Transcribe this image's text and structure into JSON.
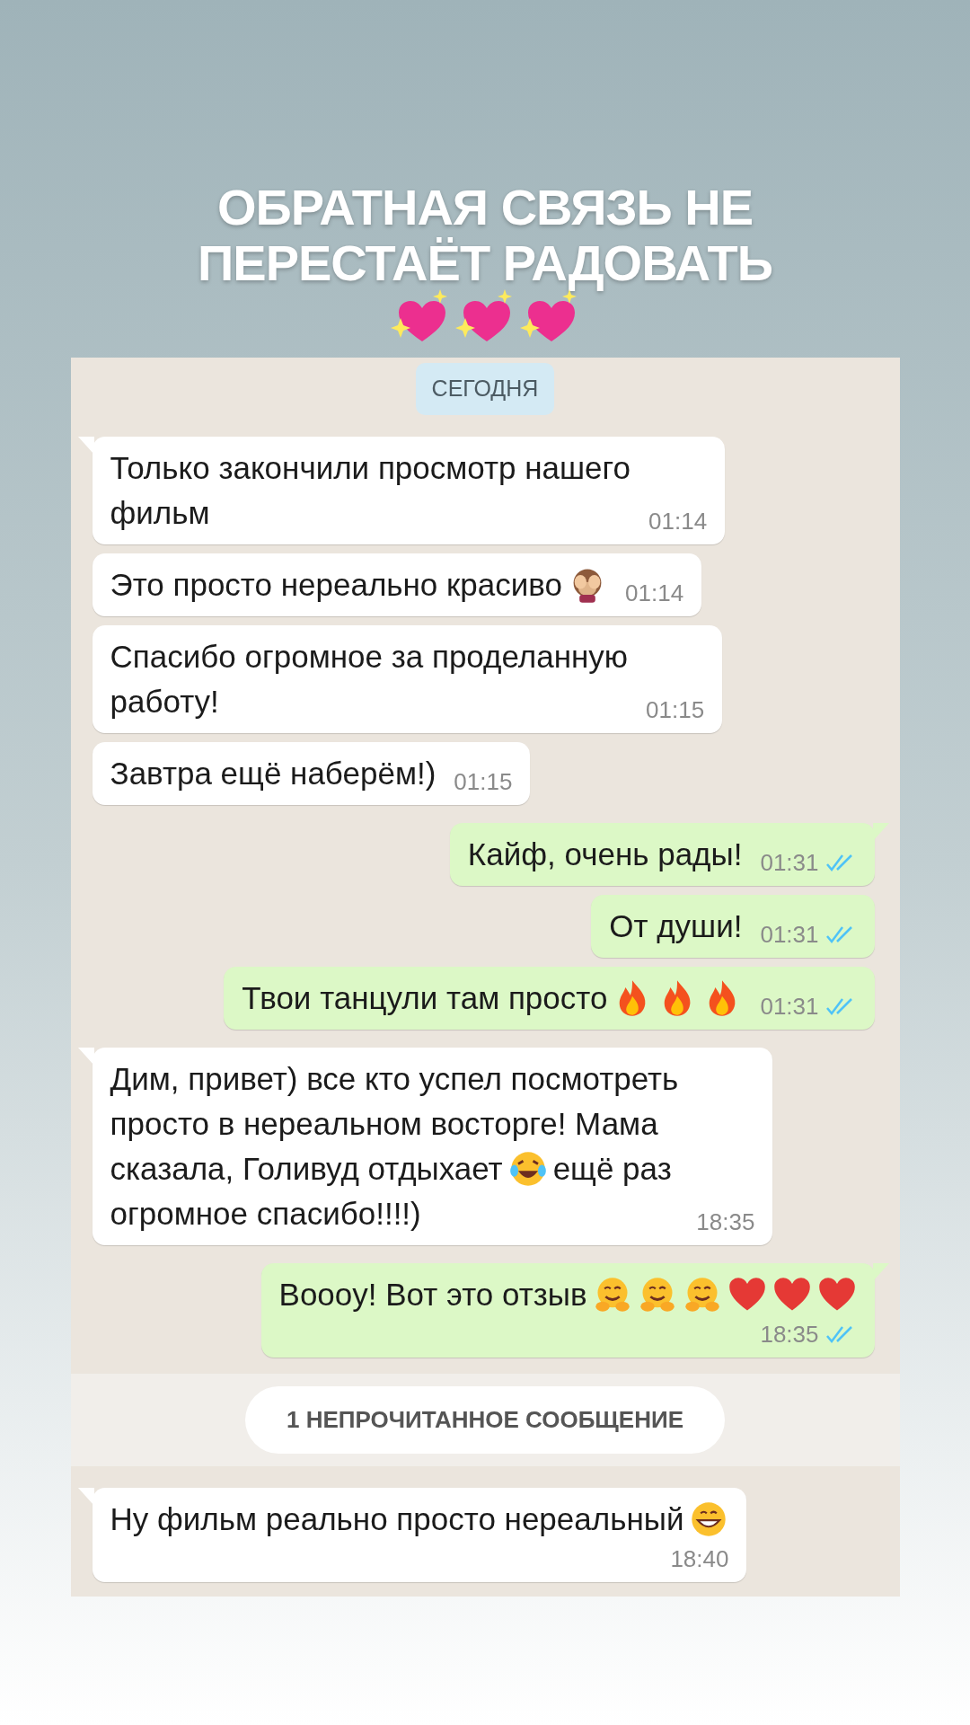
{
  "story_title": {
    "lines": [
      "ОБРАТНАЯ СВЯЗЬ НЕ",
      "ПЕРЕСТАЁТ РАДОВАТЬ"
    ]
  },
  "chat": {
    "date_chip": "СЕГОДНЯ",
    "messages": [
      {
        "outgoing": false,
        "tail": true,
        "lines": [
          [
            {
              "kind": "text",
              "text": "Только закончили просмотр нашего"
            }
          ],
          [
            {
              "kind": "text",
              "text": "фильм"
            }
          ]
        ],
        "time": "01:14"
      },
      {
        "outgoing": false,
        "tail": false,
        "lines": [
          [
            {
              "kind": "text",
              "text": "Это просто нереально красиво"
            },
            {
              "kind": "monkey"
            }
          ]
        ],
        "time": "01:14"
      },
      {
        "outgoing": false,
        "tail": false,
        "lines": [
          [
            {
              "kind": "text",
              "text": "Спасибо огромное за проделанную"
            }
          ],
          [
            {
              "kind": "text",
              "text": "работу!"
            }
          ]
        ],
        "time": "01:15"
      },
      {
        "outgoing": false,
        "tail": false,
        "lines": [
          [
            {
              "kind": "text",
              "text": "Завтра ещё наберём!)"
            }
          ]
        ],
        "time": "01:15"
      },
      {
        "outgoing": true,
        "tail": true,
        "read": true,
        "lines": [
          [
            {
              "kind": "text",
              "text": "Кайф, очень рады!"
            }
          ]
        ],
        "time": "01:31"
      },
      {
        "outgoing": true,
        "tail": false,
        "read": true,
        "lines": [
          [
            {
              "kind": "text",
              "text": "От души!"
            }
          ]
        ],
        "time": "01:31"
      },
      {
        "outgoing": true,
        "tail": false,
        "read": true,
        "lines": [
          [
            {
              "kind": "text",
              "text": "Твои танцули там просто"
            },
            {
              "kind": "fire"
            },
            {
              "kind": "fire"
            },
            {
              "kind": "fire"
            }
          ]
        ],
        "time": "01:31"
      },
      {
        "outgoing": false,
        "tail": true,
        "lines": [
          [
            {
              "kind": "text",
              "text": "Дим, привет) все кто успел посмотреть"
            }
          ],
          [
            {
              "kind": "text",
              "text": "просто в нереальном восторге! Мама"
            }
          ],
          [
            {
              "kind": "text",
              "text": "сказала, Голивуд отдыхает"
            },
            {
              "kind": "laugh"
            },
            {
              "kind": "text",
              "text": "ещё раз"
            }
          ],
          [
            {
              "kind": "text",
              "text": "огромное спасибо!!!!)"
            }
          ]
        ],
        "time": "18:35"
      },
      {
        "outgoing": true,
        "tail": true,
        "read": true,
        "lines": [
          [
            {
              "kind": "text",
              "text": "Вооoу! Вот это отзыв"
            },
            {
              "kind": "hug"
            },
            {
              "kind": "hug"
            },
            {
              "kind": "hug"
            },
            {
              "kind": "heart"
            },
            {
              "kind": "heart"
            },
            {
              "kind": "heart"
            }
          ]
        ],
        "time": "18:35",
        "time_below": true
      }
    ],
    "unread_banner": "1 НЕПРОЧИТАННОЕ СООБЩЕНИЕ",
    "after_unread": [
      {
        "outgoing": false,
        "tail": true,
        "lines": [
          [
            {
              "kind": "text",
              "text": "Ну фильм реально просто нереальный"
            },
            {
              "kind": "grin"
            }
          ]
        ],
        "time": "18:40",
        "time_below": true
      }
    ]
  }
}
